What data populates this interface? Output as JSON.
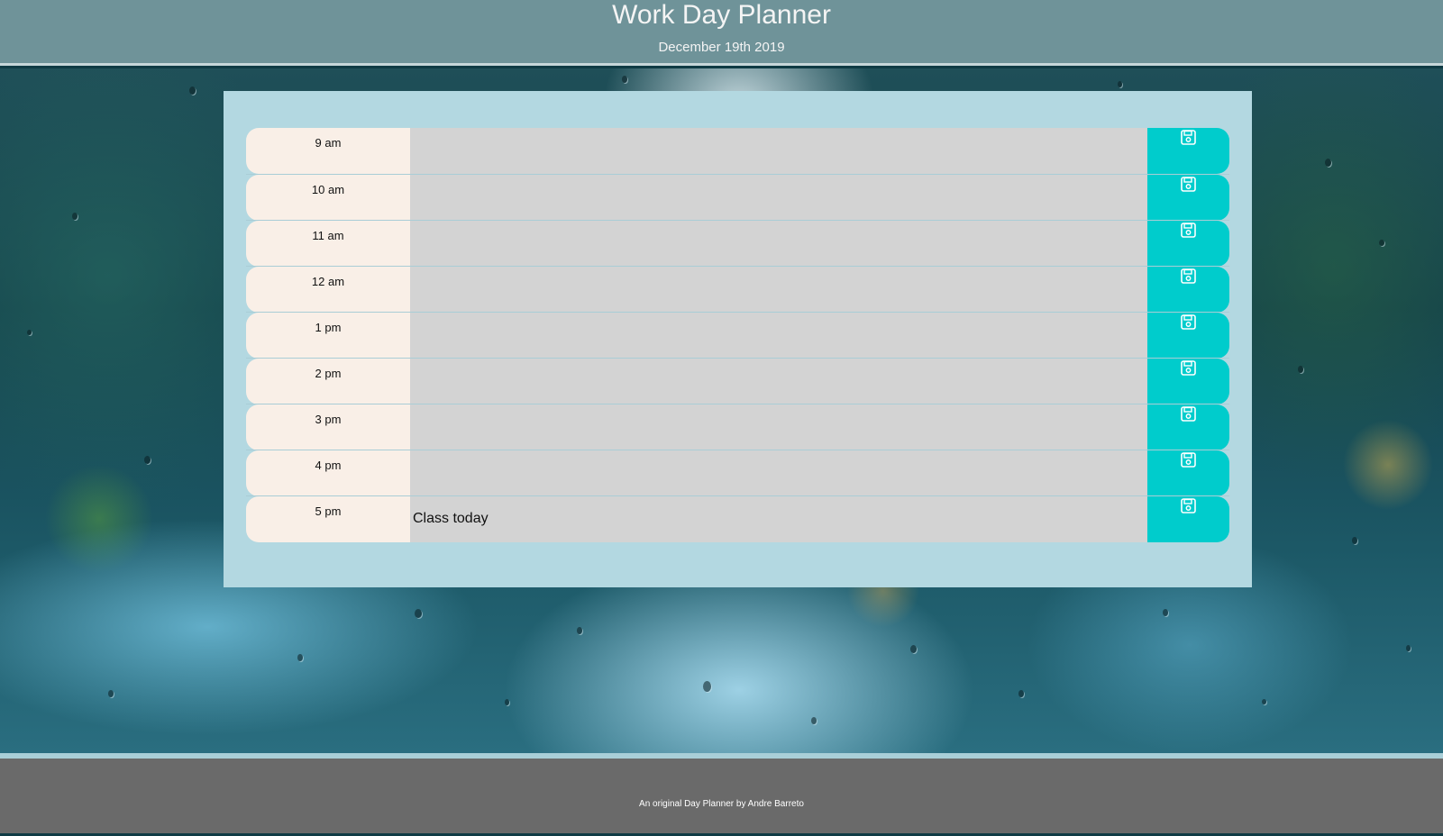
{
  "header": {
    "title": "Work Day Planner",
    "date": "December 19th 2019"
  },
  "planner": {
    "rows": [
      {
        "hour": "9 am",
        "task": ""
      },
      {
        "hour": "10 am",
        "task": ""
      },
      {
        "hour": "11 am",
        "task": ""
      },
      {
        "hour": "12 am",
        "task": ""
      },
      {
        "hour": "1 pm",
        "task": ""
      },
      {
        "hour": "2 pm",
        "task": ""
      },
      {
        "hour": "3 pm",
        "task": ""
      },
      {
        "hour": "4 pm",
        "task": ""
      },
      {
        "hour": "5 pm",
        "task": "Class today"
      }
    ],
    "save_icon": "floppy-disk-icon"
  },
  "footer": {
    "text": "An original Day Planner by Andre Barreto"
  },
  "colors": {
    "header_bg": "#6f9399",
    "container_bg": "#b3d8e1",
    "hour_bg": "#f9efe7",
    "task_bg": "#d3d3d3",
    "save_bg": "#00cccc",
    "footer_bg": "#6a6a6a"
  }
}
